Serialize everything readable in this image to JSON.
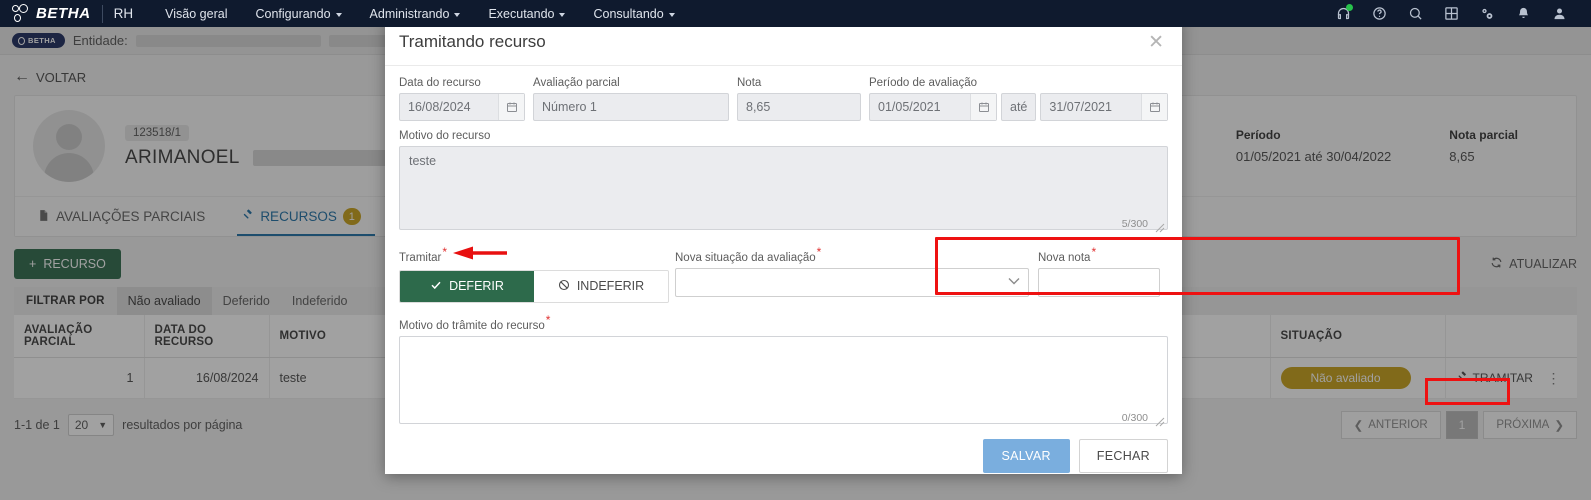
{
  "topnav": {
    "brand": "BETHA",
    "module": "RH",
    "items": [
      {
        "label": "Visão geral",
        "caret": false
      },
      {
        "label": "Configurando",
        "caret": true
      },
      {
        "label": "Administrando",
        "caret": true
      },
      {
        "label": "Executando",
        "caret": true
      },
      {
        "label": "Consultando",
        "caret": true
      }
    ],
    "icons": [
      "headset-icon",
      "help-circle-icon",
      "search-icon",
      "grid-apps-icon",
      "gears-icon",
      "bell-icon",
      "user-avatar-icon"
    ]
  },
  "entity_bar": {
    "pill": "BETHA",
    "label": "Entidade:"
  },
  "page": {
    "back_label": "VOLTAR",
    "employee": {
      "code": "123518/1",
      "name": "ARIMANOEL"
    },
    "summary": [
      {
        "header": "Período",
        "value": "01/05/2021 até 30/04/2022"
      },
      {
        "header": "Nota parcial",
        "value": "8,65"
      }
    ],
    "tabs": [
      {
        "label": "AVALIAÇÕES PARCIAIS",
        "icon": "document-icon",
        "active": false,
        "badge": ""
      },
      {
        "label": "RECURSOS",
        "icon": "gavel-icon",
        "active": true,
        "badge": "1"
      }
    ],
    "toolbar": {
      "add_label": "RECURSO",
      "refresh_label": "ATUALIZAR"
    },
    "filters": {
      "label": "FILTRAR POR",
      "options": [
        "Não avaliado",
        "Deferido",
        "Indeferido"
      ],
      "active": "Não avaliado"
    },
    "table": {
      "columns": [
        "AVALIAÇÃO PARCIAL",
        "DATA DO RECURSO",
        "MOTIVO",
        "SITUAÇÃO",
        ""
      ],
      "rows": [
        {
          "avaliacao_parcial": "1",
          "data_do_recurso": "16/08/2024",
          "motivo": "teste",
          "situacao": "Não avaliado",
          "action_label": "TRAMITAR",
          "kebab": "⋮"
        }
      ]
    },
    "pagination": {
      "range": "1-1 de 1",
      "page_size": "20",
      "per_page_label": "resultados por página",
      "prev": "ANTERIOR",
      "current": "1",
      "next": "PRÓXIMA"
    }
  },
  "modal": {
    "title": "Tramitando recurso",
    "close_icon": "✕",
    "fields": {
      "data_recurso": {
        "label": "Data do recurso",
        "value": "16/08/2024"
      },
      "avaliacao_parcial": {
        "label": "Avaliação parcial",
        "value": "Número 1"
      },
      "nota": {
        "label": "Nota",
        "value": "8,65"
      },
      "periodo": {
        "label": "Período de avaliação",
        "start": "01/05/2021",
        "separator": "até",
        "end": "31/07/2021"
      },
      "motivo_recurso": {
        "label": "Motivo do recurso",
        "value": "teste",
        "counter": "5/300"
      },
      "tramitar": {
        "label": "Tramitar",
        "required": "*",
        "options": [
          {
            "label": "DEFERIR",
            "icon": "check-icon",
            "selected": true
          },
          {
            "label": "INDEFERIR",
            "icon": "ban-icon",
            "selected": false
          }
        ]
      },
      "nova_situacao": {
        "label": "Nova situação da avaliação",
        "required": "*",
        "value": "",
        "placeholder": ""
      },
      "nova_nota": {
        "label": "Nova nota",
        "required": "*",
        "value": "",
        "placeholder": ""
      },
      "motivo_tramite": {
        "label": "Motivo do trâmite do recurso",
        "required": "*",
        "value": "",
        "counter": "0/300"
      }
    },
    "footer": {
      "save": "SALVAR",
      "close": "FECHAR"
    }
  },
  "annotations": {
    "highlight_color": "#ee1111",
    "arrow_color": "#e81010"
  }
}
